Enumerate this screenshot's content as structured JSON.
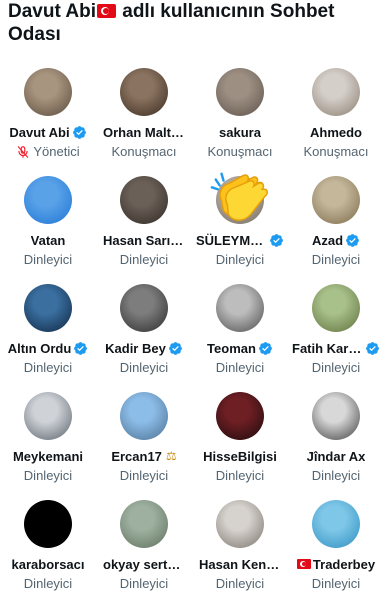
{
  "header": {
    "title_part1": "Davut Abi",
    "title_part2": " adlı kullanıcının Sohbet Odası"
  },
  "roles": {
    "host": "Yönetici",
    "speaker": "Konuşmacı",
    "listener": "Dinleyici"
  },
  "participants": [
    {
      "name": "Davut Abi",
      "role": "Yönetici",
      "verified": true,
      "muted": true,
      "avatar_colors": [
        "#a8957f",
        "#5a4a3c"
      ]
    },
    {
      "name": "Orhan Maltepe",
      "role": "Konuşmacı",
      "verified": false,
      "avatar_colors": [
        "#8a7360",
        "#3a2a1e"
      ]
    },
    {
      "name": "sakura",
      "role": "Konuşmacı",
      "verified": false,
      "avatar_colors": [
        "#9d8f82",
        "#5c524a"
      ]
    },
    {
      "name": "Ahmedo",
      "role": "Konuşmacı",
      "verified": false,
      "avatar_colors": [
        "#d4cfc9",
        "#8b7d70"
      ]
    },
    {
      "name": "Vatan",
      "role": "Dinleyici",
      "verified": false,
      "avatar_colors": [
        "#5aa2e8",
        "#1d74d4"
      ]
    },
    {
      "name": "Hasan Sarıkaya",
      "role": "Dinleyici",
      "verified": false,
      "avatar_colors": [
        "#6b6058",
        "#2e2823"
      ]
    },
    {
      "name": "SÜLEYMAN",
      "role": "Dinleyici",
      "verified": true,
      "avatar_colors": [
        "#b9b0a6",
        "#6f665c"
      ]
    },
    {
      "name": "Azad",
      "role": "Dinleyici",
      "verified": true,
      "avatar_colors": [
        "#c4b79a",
        "#7a6a48"
      ]
    },
    {
      "name": "Altın Ordu",
      "role": "Dinleyici",
      "verified": true,
      "avatar_colors": [
        "#3a6fa0",
        "#0f2540"
      ]
    },
    {
      "name": "Kadir Bey",
      "role": "Dinleyici",
      "verified": true,
      "avatar_colors": [
        "#7d7d7d",
        "#2a2a2a"
      ]
    },
    {
      "name": "Teoman",
      "role": "Dinleyici",
      "verified": true,
      "avatar_colors": [
        "#bdbdbd",
        "#4a4a4a"
      ]
    },
    {
      "name": "Fatih Karaca",
      "role": "Dinleyici",
      "verified": true,
      "avatar_colors": [
        "#a8c08a",
        "#5e6f3a"
      ]
    },
    {
      "name": "Meykemani",
      "role": "Dinleyici",
      "verified": false,
      "avatar_colors": [
        "#cfd3d8",
        "#59606a"
      ]
    },
    {
      "name": "Ercan17",
      "role": "Dinleyici",
      "verified": false,
      "scale": true,
      "avatar_colors": [
        "#8cbde8",
        "#4a6f90"
      ]
    },
    {
      "name": "HisseBilgisi",
      "role": "Dinleyici",
      "verified": false,
      "avatar_colors": [
        "#6e1f24",
        "#1c0a0c"
      ]
    },
    {
      "name": "Jîndar Ax",
      "role": "Dinleyici",
      "verified": false,
      "avatar_colors": [
        "#d8d8d8",
        "#3d3d3d"
      ]
    },
    {
      "name": "karaborsacı",
      "role": "Dinleyici",
      "verified": false,
      "avatar_colors": [
        "#000000",
        "#000000"
      ]
    },
    {
      "name": "okyay sertkaya",
      "role": "Dinleyici",
      "verified": false,
      "avatar_colors": [
        "#9eb1a0",
        "#5f6e5c"
      ]
    },
    {
      "name": "Hasan Kenan",
      "role": "Dinleyici",
      "verified": false,
      "avatar_colors": [
        "#d6d2cd",
        "#7a736c"
      ]
    },
    {
      "name": "Traderbey",
      "role": "Dinleyici",
      "verified": false,
      "flag": true,
      "avatar_colors": [
        "#7fc7e8",
        "#2c8fbf"
      ]
    }
  ],
  "colors": {
    "verified_blue": "#1d9bf0",
    "muted_red": "#f4212e",
    "secondary_text": "#536471"
  }
}
